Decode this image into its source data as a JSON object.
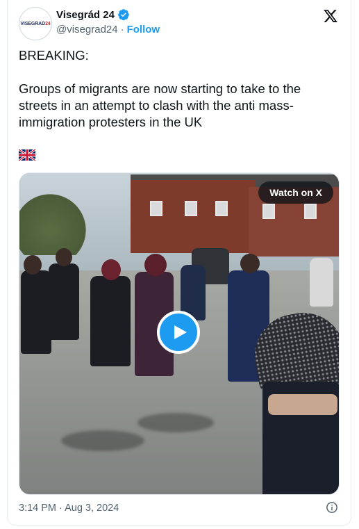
{
  "author": {
    "display_name": "Visegrád 24",
    "handle": "@visegrad24",
    "separator": "·",
    "follow_label": "Follow",
    "avatar_text": {
      "main": "VISEGRAD",
      "num": "24"
    },
    "verified": true
  },
  "tweet": {
    "text": "BREAKING:\n\nGroups of migrants are now starting to take to the streets in an attempt to clash with the anti mass-immigration protesters in the UK",
    "flag_icon": "uk-flag-icon"
  },
  "media": {
    "watch_label": "Watch on X",
    "play_icon": "play-icon"
  },
  "footer": {
    "timestamp": "3:14 PM · Aug 3, 2024"
  },
  "colors": {
    "accent": "#1d9bf0",
    "text": "#0f1419",
    "muted": "#536471"
  }
}
